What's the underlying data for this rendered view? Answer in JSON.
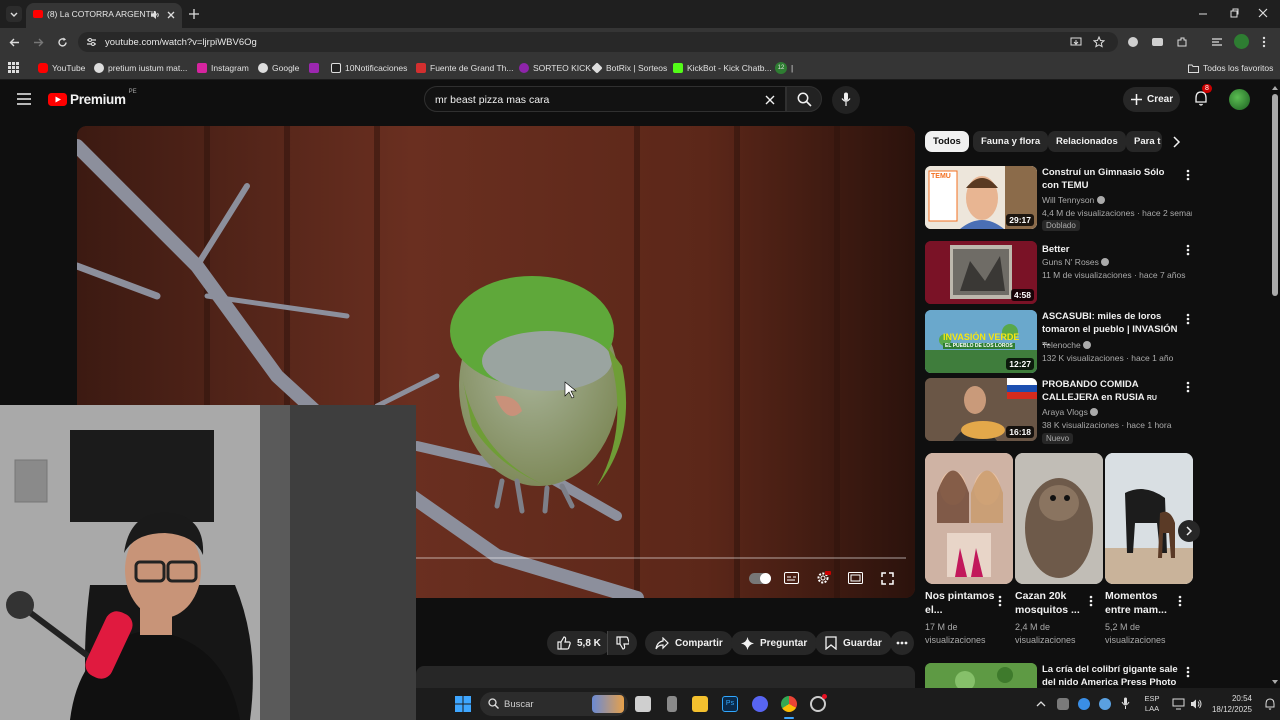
{
  "browser": {
    "tab_title": "(8) La COTORRA ARGENTINA",
    "url": "youtube.com/watch?v=ljrpiWBV6Og",
    "bookmarks": [
      "YouTube",
      "pretium iustum mat...",
      "Instagram",
      "Google",
      "10Notificaciones",
      "Fuente de Grand Th...",
      "SORTEO KICK",
      "BotRix | Sorteos",
      "KickBot - Kick Chatb...",
      "12",
      "|"
    ],
    "all_favorites": "Todos los favoritos"
  },
  "youtube": {
    "logo": "Premium",
    "logo_region": "PE",
    "search_query": "mr beast pizza mas cara",
    "create_label": "Crear",
    "notifications_count": "8"
  },
  "actions": {
    "likes": "5,8 K",
    "share": "Compartir",
    "ask": "Preguntar",
    "save": "Guardar"
  },
  "chips": [
    "Todos",
    "Fauna y flora",
    "Relacionados",
    "Para t"
  ],
  "recommendations": [
    {
      "title": "Construí un Gimnasio Sólo con TEMU",
      "channel": "Will Tennyson",
      "meta": "4,4 M de visualizaciones · hace 2 seman...",
      "duration": "29:17",
      "badge": "Doblado",
      "thumb_text": "TEMU"
    },
    {
      "title": "Better",
      "channel": "Guns N' Roses",
      "meta": "11 M de visualizaciones · hace 7 años",
      "duration": "4:58",
      "badge": ""
    },
    {
      "title": "ASCASUBI: miles de loros tomaron el pueblo | INVASIÓN ...",
      "channel": "Telenoche",
      "meta": "132 K visualizaciones · hace 1 año",
      "duration": "12:27",
      "badge": "",
      "thumb_text": "INVASIÓN VERDE",
      "thumb_sub": "EL PUEBLO DE LOS LOROS"
    },
    {
      "title": "PROBANDO COMIDA CALLEJERA en RUSIA",
      "title_suffix": "RU",
      "channel": "Araya Vlogs",
      "meta": "38 K visualizaciones · hace 1 hora",
      "duration": "16:18",
      "badge": "Nuevo"
    },
    {
      "title": "La cría del colibrí gigante sale del nido America Press Photo ...",
      "channel": "",
      "meta": "",
      "duration": "",
      "badge": ""
    }
  ],
  "shorts": [
    {
      "title": "Nos pintamos el...",
      "views": "17 M de visualizaciones"
    },
    {
      "title": "Cazan 20k mosquitos ...",
      "views": "2,4 M de visualizaciones"
    },
    {
      "title": "Momentos entre mam...",
      "views": "5,2 M de visualizaciones"
    }
  ],
  "taskbar": {
    "search_label": "Buscar",
    "lang_top": "ESP",
    "lang_bottom": "LAA",
    "time": "20:54",
    "date": "18/12/2025"
  },
  "colors": {
    "youtube_red": "#ff0000",
    "parrot_green": "#5fa83a",
    "accent_blue": "#3ea6ff"
  }
}
